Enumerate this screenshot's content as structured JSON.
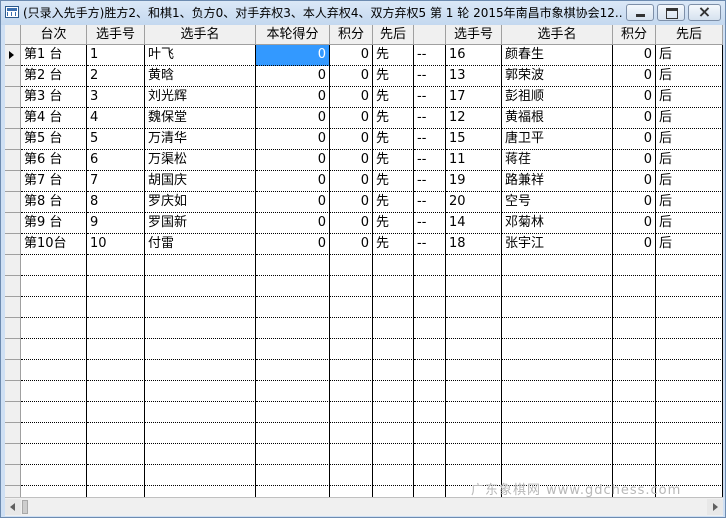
{
  "window": {
    "title": "(只录入先手方)胜方2、和棋1、负方0、对手弃权3、本人弃权4、双方弃权5  第 1 轮 2015年南昌市象棋协会12..."
  },
  "table": {
    "columns": [
      "台次",
      "选手号",
      "选手名",
      "本轮得分",
      "积分",
      "先后",
      "",
      "选手号",
      "选手名",
      "积分",
      "先后"
    ],
    "rows": [
      [
        "第1  台",
        "1",
        "叶飞",
        "0",
        "0",
        "先",
        "--",
        "16",
        "颜春生",
        "0",
        "后"
      ],
      [
        "第2  台",
        "2",
        "黄晗",
        "0",
        "0",
        "先",
        "--",
        "13",
        "郭荣波",
        "0",
        "后"
      ],
      [
        "第3  台",
        "3",
        "刘光辉",
        "0",
        "0",
        "先",
        "--",
        "17",
        "彭祖顺",
        "0",
        "后"
      ],
      [
        "第4  台",
        "4",
        "魏保堂",
        "0",
        "0",
        "先",
        "--",
        "12",
        "黄福根",
        "0",
        "后"
      ],
      [
        "第5  台",
        "5",
        "万清华",
        "0",
        "0",
        "先",
        "--",
        "15",
        "唐卫平",
        "0",
        "后"
      ],
      [
        "第6  台",
        "6",
        "万渠松",
        "0",
        "0",
        "先",
        "--",
        "11",
        "蒋荏",
        "0",
        "后"
      ],
      [
        "第7  台",
        "7",
        "胡国庆",
        "0",
        "0",
        "先",
        "--",
        "19",
        "路兼祥",
        "0",
        "后"
      ],
      [
        "第8  台",
        "8",
        "罗庆如",
        "0",
        "0",
        "先",
        "--",
        "20",
        "空号",
        "0",
        "后"
      ],
      [
        "第9  台",
        "9",
        "罗国新",
        "0",
        "0",
        "先",
        "--",
        "14",
        "邓菊林",
        "0",
        "后"
      ],
      [
        "第10台",
        "10",
        "付雷",
        "0",
        "0",
        "先",
        "--",
        "18",
        "张宇江",
        "0",
        "后"
      ]
    ],
    "selected_row": 0,
    "selected_col": 3,
    "empty_rows": 12
  },
  "watermark": "广东象棋网 www.gdchess.com",
  "colors": {
    "selection": "#3399ff",
    "header_bg": "#f0f0f0",
    "title_bg": "#cfe0f4"
  }
}
